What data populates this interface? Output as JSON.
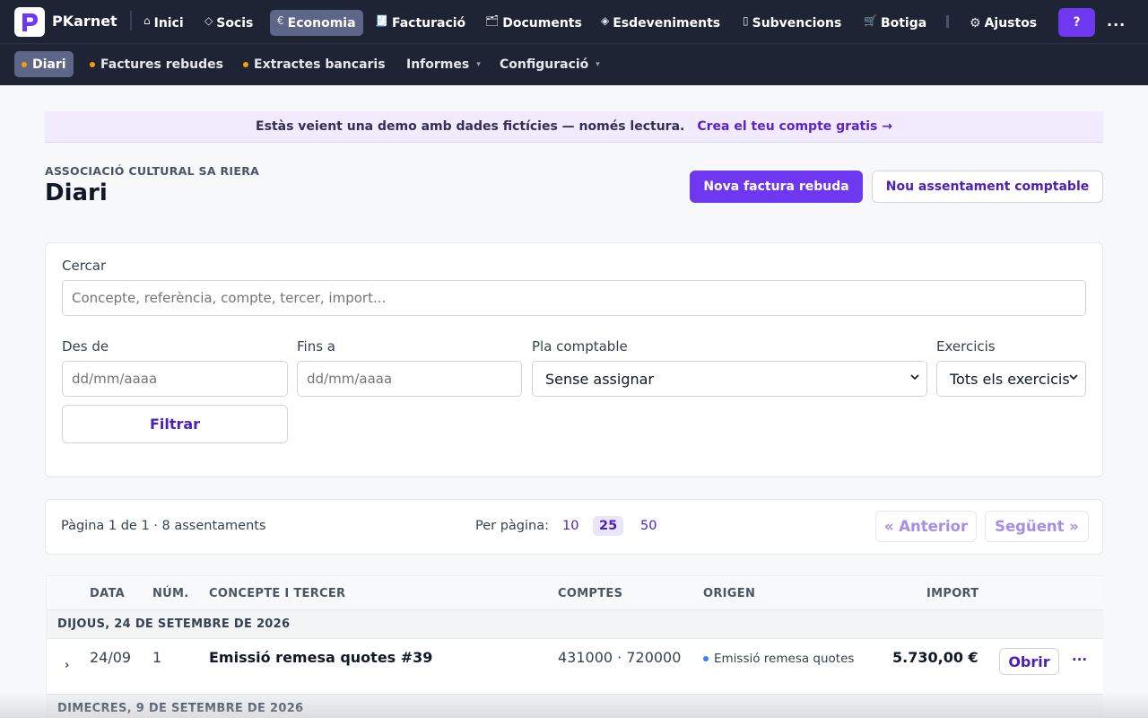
{
  "app": {
    "brand": "PKarnet",
    "logo_letter": "P",
    "help_label": "?",
    "more_label": "..."
  },
  "topnav": [
    {
      "icon": "⌂",
      "icon_name": "home-icon",
      "label": "Inici"
    },
    {
      "icon": "◇",
      "icon_name": "diamond-icon",
      "label": "Socis"
    },
    {
      "icon": "€",
      "icon_name": "euro-icon",
      "label": "Economia",
      "active": true
    },
    {
      "icon": "🧾",
      "icon_name": "receipt-icon",
      "label": "Facturació"
    },
    {
      "icon": "🗂",
      "icon_name": "folder-icon",
      "label": "Documents"
    },
    {
      "icon": "◈",
      "icon_name": "event-icon",
      "label": "Esdeveniments"
    },
    {
      "icon": "▯",
      "icon_name": "grant-icon",
      "label": "Subvencions"
    },
    {
      "icon": "🛒",
      "icon_name": "cart-icon",
      "label": "Botiga"
    },
    {
      "icon": "⚙",
      "icon_name": "gear-icon",
      "label": "Ajustos"
    }
  ],
  "subnav": [
    {
      "label": "Diari",
      "dot": true,
      "active": true
    },
    {
      "label": "Factures rebudes",
      "dot": true
    },
    {
      "label": "Extractes bancaris",
      "dot": true
    },
    {
      "label": "Informes",
      "caret": "▾"
    },
    {
      "label": "Configuració",
      "caret": "▾"
    }
  ],
  "banner": {
    "message": "Estàs veient una demo amb dades fictícies — només lectura.",
    "link": "Crea el teu compte gratis →"
  },
  "header": {
    "org": "ASSOCIACIÓ CULTURAL SA RIERA",
    "title": "Diari",
    "primary_button": "Nova factura rebuda",
    "secondary_button": "Nou assentament comptable"
  },
  "filters": {
    "search_label": "Cercar",
    "search_placeholder": "Concepte, referència, compte, tercer, import...",
    "from_label": "Des de",
    "from_placeholder": "dd/mm/aaaa",
    "to_label": "Fins a",
    "to_placeholder": "dd/mm/aaaa",
    "plan_label": "Pla comptable",
    "plan_value": "Sense assignar",
    "year_label": "Exercicis",
    "year_value": "Tots els exercicis",
    "filter_button": "Filtrar"
  },
  "pagination": {
    "info": "Pàgina 1 de 1 · 8 assentaments",
    "per_page_label": "Per pàgina:",
    "options": [
      "10",
      "25",
      "50"
    ],
    "selected": "25",
    "prev": "« Anterior",
    "next": "Següent »"
  },
  "table": {
    "columns": [
      "DATA",
      "NÚM.",
      "CONCEPTE I TERCER",
      "COMPTES",
      "ORIGEN",
      "IMPORT"
    ],
    "groups": [
      {
        "heading": "DIJOUS, 24 DE SETEMBRE DE 2026",
        "rows": [
          {
            "expand": "›",
            "date": "24/09",
            "num": "1",
            "concept": "Emissió remesa quotes #39",
            "accounts": "431000 · 720000",
            "origin": "Emissió remesa quotes",
            "amount": "5.730,00 €",
            "open": "Obrir",
            "more": "···"
          }
        ]
      },
      {
        "heading": "DIMECRES, 9 DE SETEMBRE DE 2026",
        "rows": []
      }
    ]
  },
  "colors": {
    "nav_bg": "#1e2434",
    "accent": "#6d38f0",
    "link": "#4c1fb8",
    "banner_bg": "#f1ebfd"
  }
}
